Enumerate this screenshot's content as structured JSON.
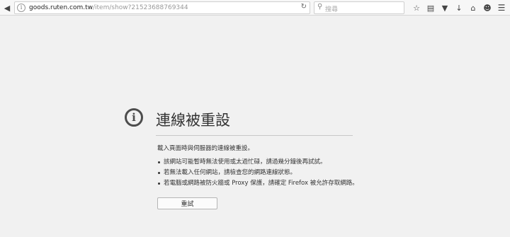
{
  "toolbar": {
    "url_domain": "goods.ruten.com.tw",
    "url_path": "/item/show?21523688769344",
    "search_placeholder": "搜尋"
  },
  "error": {
    "title": "連線被重設",
    "description": "載入頁面時與伺服器的連線被重設。",
    "items": [
      "該網站可能暫時無法使用或太過忙碌，請過幾分鐘後再試試。",
      "若無法載入任何網站，請檢查您的網路連線狀態。",
      "若電腦或網路被防火牆或 Proxy 保護，請確定 Firefox 被允許存取網路。"
    ],
    "retry_label": "重試"
  }
}
